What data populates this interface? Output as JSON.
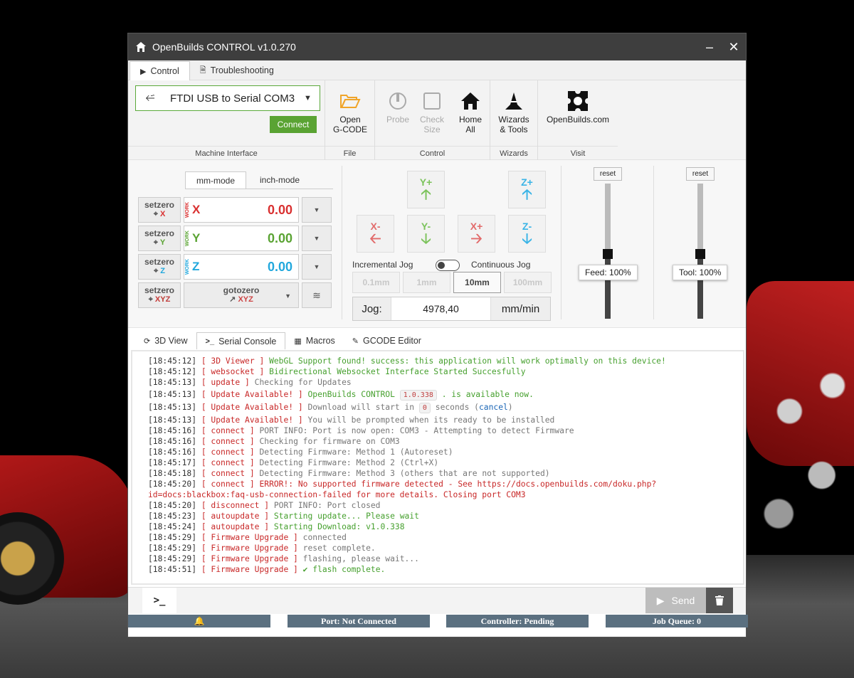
{
  "window": {
    "title": "OpenBuilds CONTROL v1.0.270",
    "minimize": "–",
    "close": "✕"
  },
  "top_tabs": [
    {
      "label": "Control"
    },
    {
      "label": "Troubleshooting"
    }
  ],
  "ribbon": {
    "port": "FTDI USB to Serial COM3",
    "connect": "Connect",
    "groups": {
      "machine": "Machine Interface",
      "file": "File",
      "control": "Control",
      "wizards": "Wizards",
      "visit": "Visit"
    },
    "open_gcode": {
      "line1": "Open",
      "line2": "G-CODE"
    },
    "probe": "Probe",
    "check_size": {
      "line1": "Check",
      "line2": "Size"
    },
    "home_all": {
      "line1": "Home",
      "line2": "All"
    },
    "wizards": {
      "line1": "Wizards",
      "line2": "& Tools"
    },
    "openbuilds": "OpenBuilds.com"
  },
  "dro": {
    "mode_tabs": [
      "mm-mode",
      "inch-mode"
    ],
    "setzero": "setzero",
    "work": "WORK",
    "axes": [
      {
        "name": "X",
        "value": "0.00",
        "color": "#d93030"
      },
      {
        "name": "Y",
        "value": "0.00",
        "color": "#5aa333"
      },
      {
        "name": "Z",
        "value": "0.00",
        "color": "#22a8dd"
      }
    ],
    "xyz": "XYZ",
    "gotozero": "gotozero"
  },
  "jog": {
    "buttons": {
      "yplus": "Y+",
      "zplus": "Z+",
      "xminus": "X-",
      "yminus": "Y-",
      "xplus": "X+",
      "zminus": "Z-"
    },
    "incremental": "Incremental Jog",
    "continuous": "Continuous Jog",
    "steps": [
      "0.1mm",
      "1mm",
      "10mm",
      "100mm"
    ],
    "active_step": "10mm",
    "label": "Jog:",
    "value": "4978,40",
    "unit": "mm/min"
  },
  "overrides": {
    "reset": "reset",
    "feed": "Feed: 100%",
    "tool": "Tool: 100%",
    "feed_percent": 100,
    "tool_percent": 100
  },
  "bottom_tabs": [
    {
      "label": "3D View"
    },
    {
      "label": "Serial Console"
    },
    {
      "label": "Macros"
    },
    {
      "label": "GCODE Editor"
    }
  ],
  "console": [
    {
      "ts": "[18:45:12]",
      "src": "[ 3D Viewer ]",
      "msg": "WebGL Support found! success: this application will work optimally on this device!",
      "cls": "c-green"
    },
    {
      "ts": "[18:45:12]",
      "src": "[ websocket ]",
      "msg": "Bidirectional Websocket Interface Started Succesfully",
      "cls": "c-green"
    },
    {
      "ts": "[18:45:13]",
      "src": "[ update ]",
      "msg": "Checking for Updates",
      "cls": "c-grey"
    },
    {
      "ts": "[18:45:13]",
      "src": "[ Update Available! ]",
      "msg": "OpenBuilds CONTROL",
      "pill": "1.0.338",
      "msg2": ". is available now.",
      "cls": "c-green",
      "cls2": "c-green"
    },
    {
      "ts": "[18:45:13]",
      "src": "[ Update Available! ]",
      "msg": "Download will start in",
      "pill": "0",
      "msg2": "seconds (",
      "link": "cancel",
      "msg3": ")",
      "cls": "c-grey",
      "cls2": "c-grey"
    },
    {
      "ts": "[18:45:13]",
      "src": "[ Update Available! ]",
      "msg": "You will be prompted when its ready to be installed",
      "cls": "c-grey"
    },
    {
      "ts": "[18:45:16]",
      "src": "[ connect ]",
      "msg": "PORT INFO: Port is now open: COM3 - Attempting to detect Firmware",
      "cls": "c-grey"
    },
    {
      "ts": "[18:45:16]",
      "src": "[ connect ]",
      "msg": "Checking for firmware on COM3",
      "cls": "c-grey"
    },
    {
      "ts": "[18:45:16]",
      "src": "[ connect ]",
      "msg": "Detecting Firmware: Method 1 (Autoreset)",
      "cls": "c-grey"
    },
    {
      "ts": "[18:45:17]",
      "src": "[ connect ]",
      "msg": "Detecting Firmware: Method 2 (Ctrl+X)",
      "cls": "c-grey"
    },
    {
      "ts": "[18:45:18]",
      "src": "[ connect ]",
      "msg": "Detecting Firmware: Method 3 (others that are not supported)",
      "cls": "c-grey"
    },
    {
      "ts": "[18:45:20]",
      "src": "[ connect ]",
      "msg": "ERROR!: No supported firmware detected - See https://docs.openbuilds.com/doku.php?",
      "cls": "c-red"
    },
    {
      "ts": "",
      "src": "",
      "msg": "id=docs:blackbox:faq-usb-connection-failed for more details. Closing port COM3",
      "cls": "c-red",
      "cont": true
    },
    {
      "ts": "[18:45:20]",
      "src": "[ disconnect ]",
      "msg": "PORT INFO: Port closed",
      "cls": "c-grey"
    },
    {
      "ts": "[18:45:23]",
      "src": "[ autoupdate ]",
      "msg": "Starting update... Please wait",
      "cls": "c-green"
    },
    {
      "ts": "[18:45:24]",
      "src": "[ autoupdate ]",
      "msg": "Starting Download: v1.0.338",
      "cls": "c-green"
    },
    {
      "ts": "[18:45:29]",
      "src": "[ Firmware Upgrade ]",
      "msg": "connected",
      "cls": "c-grey"
    },
    {
      "ts": "[18:45:29]",
      "src": "[ Firmware Upgrade ]",
      "msg": "reset complete.",
      "cls": "c-grey"
    },
    {
      "ts": "[18:45:29]",
      "src": "[ Firmware Upgrade ]",
      "msg": "flashing, please wait...",
      "cls": "c-grey"
    },
    {
      "ts": "[18:45:51]",
      "src": "[ Firmware Upgrade ]",
      "msg": "✔ flash complete.",
      "cls": "c-green"
    }
  ],
  "command": {
    "prompt": ">_",
    "send": "Send"
  },
  "status": {
    "notifications": "🔔",
    "port": "Port: Not Connected",
    "controller": "Controller: Pending",
    "queue": "Job Queue: 0"
  }
}
